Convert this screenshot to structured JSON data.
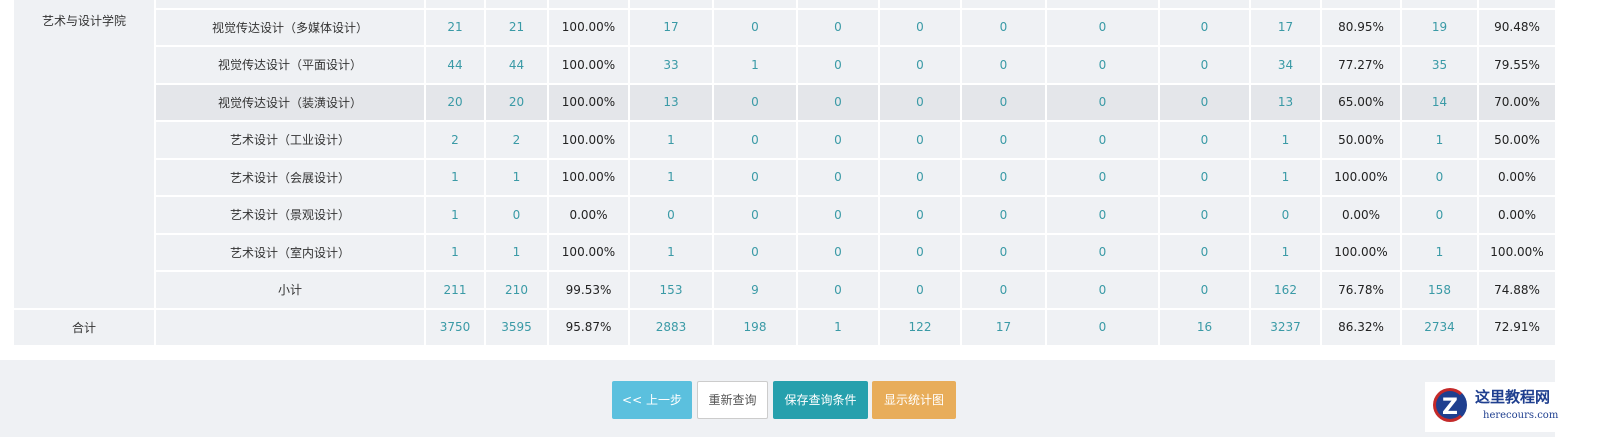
{
  "college": "艺术与设计学院",
  "rows": [
    {
      "name": "",
      "vals": [
        "",
        "",
        "",
        "",
        "",
        "",
        "",
        "",
        "",
        "",
        "",
        "",
        "",
        ""
      ]
    },
    {
      "name": "视觉传达设计（多媒体设计）",
      "vals": [
        "21",
        "21",
        "100.00%",
        "17",
        "0",
        "0",
        "0",
        "0",
        "0",
        "0",
        "17",
        "80.95%",
        "19",
        "90.48%"
      ]
    },
    {
      "name": "视觉传达设计（平面设计）",
      "vals": [
        "44",
        "44",
        "100.00%",
        "33",
        "1",
        "0",
        "0",
        "0",
        "0",
        "0",
        "34",
        "77.27%",
        "35",
        "79.55%"
      ]
    },
    {
      "name": "视觉传达设计（装潢设计）",
      "vals": [
        "20",
        "20",
        "100.00%",
        "13",
        "0",
        "0",
        "0",
        "0",
        "0",
        "0",
        "13",
        "65.00%",
        "14",
        "70.00%"
      ],
      "highlight": true
    },
    {
      "name": "艺术设计（工业设计）",
      "vals": [
        "2",
        "2",
        "100.00%",
        "1",
        "0",
        "0",
        "0",
        "0",
        "0",
        "0",
        "1",
        "50.00%",
        "1",
        "50.00%"
      ]
    },
    {
      "name": "艺术设计（会展设计）",
      "vals": [
        "1",
        "1",
        "100.00%",
        "1",
        "0",
        "0",
        "0",
        "0",
        "0",
        "0",
        "1",
        "100.00%",
        "0",
        "0.00%"
      ]
    },
    {
      "name": "艺术设计（景观设计）",
      "vals": [
        "1",
        "0",
        "0.00%",
        "0",
        "0",
        "0",
        "0",
        "0",
        "0",
        "0",
        "0",
        "0.00%",
        "0",
        "0.00%"
      ]
    },
    {
      "name": "艺术设计（室内设计）",
      "vals": [
        "1",
        "1",
        "100.00%",
        "1",
        "0",
        "0",
        "0",
        "0",
        "0",
        "0",
        "1",
        "100.00%",
        "1",
        "100.00%"
      ]
    },
    {
      "name": "小计",
      "vals": [
        "211",
        "210",
        "99.53%",
        "153",
        "9",
        "0",
        "0",
        "0",
        "0",
        "0",
        "162",
        "76.78%",
        "158",
        "74.88%"
      ]
    }
  ],
  "total": {
    "label": "合计",
    "name": "",
    "vals": [
      "3750",
      "3595",
      "95.87%",
      "2883",
      "198",
      "1",
      "122",
      "17",
      "0",
      "16",
      "3237",
      "86.32%",
      "2734",
      "72.91%"
    ]
  },
  "buttons": {
    "prev": "<< 上一步",
    "reset": "重新查询",
    "save": "保存查询条件",
    "chart": "显示统计图"
  },
  "logo": {
    "title": "这里教程网",
    "url": "herecours.com",
    "mark": "Z"
  },
  "colors": {
    "num": "#3a9aa6",
    "prev": "#5bc0de",
    "save": "#26a0ad",
    "chart": "#e8ad5a"
  }
}
